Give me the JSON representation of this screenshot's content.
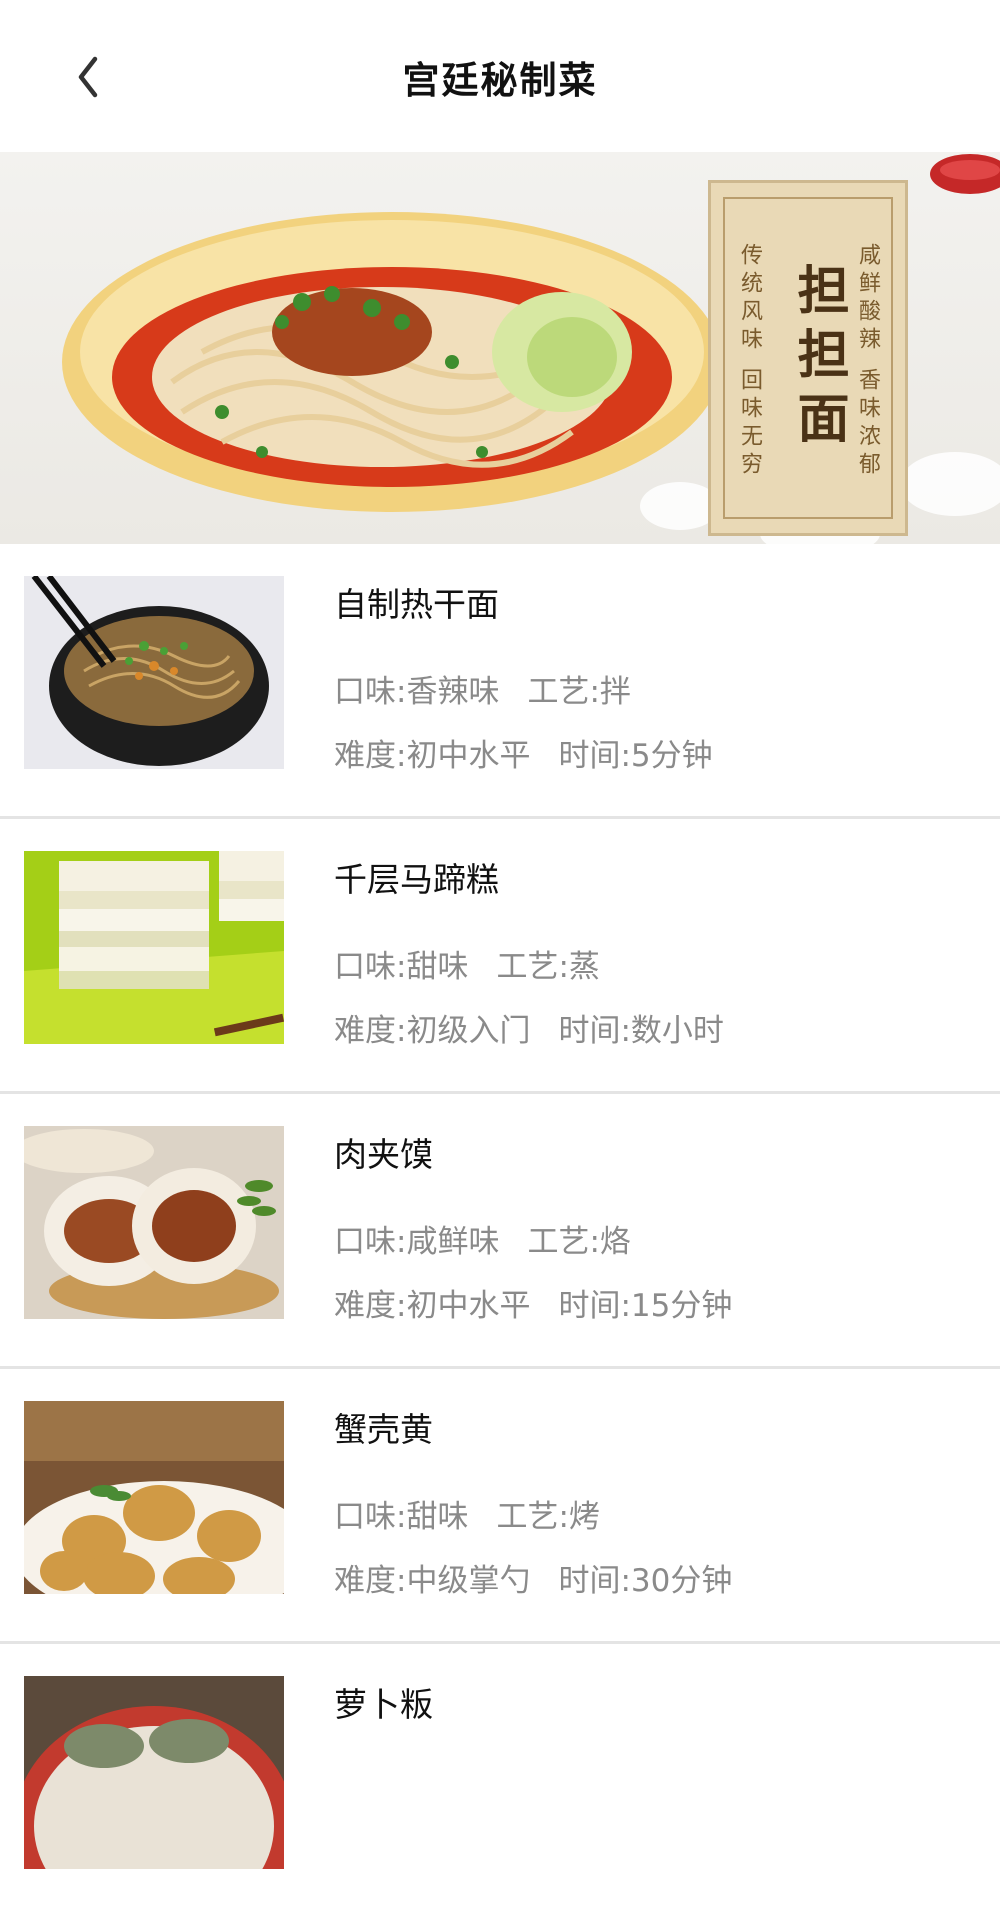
{
  "header": {
    "title": "宫廷秘制菜",
    "back_icon": "chevron-left-icon"
  },
  "banner": {
    "plaque_title": "担担面",
    "plaque_left": "传统风味 回味无穷",
    "plaque_right": "咸鲜酸辣 香味浓郁"
  },
  "recipes": [
    {
      "name": "自制热干面",
      "flavor": "口味:香辣味",
      "technique": "工艺:拌",
      "difficulty": "难度:初中水平",
      "time": "时间:5分钟"
    },
    {
      "name": "千层马蹄糕",
      "flavor": "口味:甜味",
      "technique": "工艺:蒸",
      "difficulty": "难度:初级入门",
      "time": "时间:数小时"
    },
    {
      "name": "肉夹馍",
      "flavor": "口味:咸鲜味",
      "technique": "工艺:烙",
      "difficulty": "难度:初中水平",
      "time": "时间:15分钟"
    },
    {
      "name": "蟹壳黄",
      "flavor": "口味:甜味",
      "technique": "工艺:烤",
      "difficulty": "难度:中级掌勺",
      "time": "时间:30分钟"
    },
    {
      "name": "萝卜粄"
    }
  ]
}
